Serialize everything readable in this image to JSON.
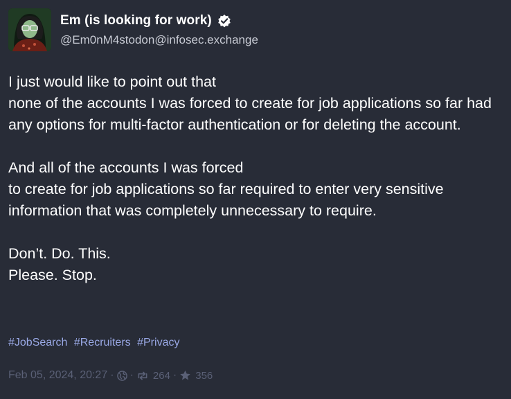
{
  "author": {
    "display_name": "Em (is looking for work)",
    "handle": "@Em0nM4stodon@infosec.exchange",
    "avatar_icon": "avatar-image",
    "verified_icon": "verified-badge-icon"
  },
  "post": {
    "paragraphs": [
      "I just would like to point out that\nnone of the accounts I was forced to create for job applications so far had any options for multi-factor authentication or for deleting the account.",
      "And all of the accounts I was forced\nto create for job applications so far required to enter very sensitive information that was completely unnecessary to require.",
      "Don’t. Do. This.\nPlease. Stop."
    ],
    "hashtags": [
      "#JobSearch",
      "#Recruiters",
      "#Privacy"
    ]
  },
  "meta": {
    "timestamp": "Feb 05, 2024, 20:27",
    "separator": "·",
    "visibility_icon": "globe-icon",
    "boost_icon": "boost-icon",
    "boost_count": "264",
    "favourite_icon": "star-icon",
    "favourite_count": "356"
  },
  "colors": {
    "background": "#282c37",
    "text": "#ffffff",
    "handle": "#c8cbd4",
    "hashtag": "#9aa9e6",
    "meta": "#5a6076"
  }
}
